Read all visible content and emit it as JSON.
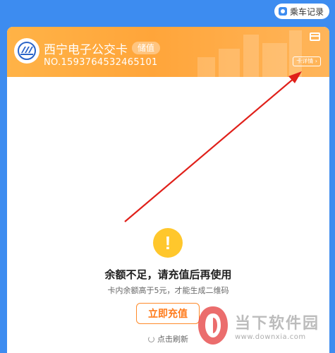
{
  "topbar": {
    "ride_record_label": "乘车记录"
  },
  "card": {
    "name": "西宁电子公交卡",
    "tag": "储值",
    "number": "NO.1593764532465101",
    "detail_label": "卡详情 ›"
  },
  "status": {
    "warning_glyph": "!",
    "title": "余额不足，请充值后再使用",
    "subtitle": "卡内余额高于5元，才能生成二维码",
    "recharge_label": "立即充值",
    "refresh_label": "点击刷新"
  },
  "watermark": {
    "name": "当下软件园",
    "url": "www.downxia.com"
  },
  "colors": {
    "background": "#3d8cf0",
    "card_header": "#ffa53a",
    "accent_orange": "#ff7a1a",
    "warning_yellow": "#ffc72c",
    "annotation_arrow": "#e0201a"
  }
}
